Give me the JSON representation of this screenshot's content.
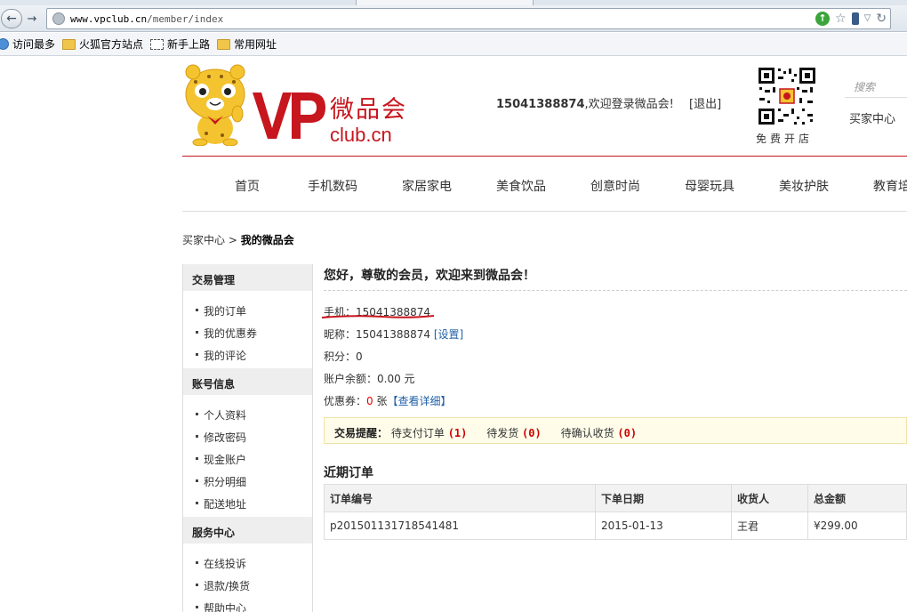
{
  "browser": {
    "url_host": "www.vpclub.cn",
    "url_path": "/member/index",
    "bookmarks": [
      "访问最多",
      "火狐官方站点",
      "新手上路",
      "常用网址"
    ]
  },
  "header": {
    "brand_cn": "微品会",
    "brand_en": "club.cn",
    "welcome_phone": "15041388874",
    "welcome_text": ",欢迎登录微品会!",
    "logout_label": "[退出]",
    "qr_caption": "免费开店",
    "search_placeholder": "搜索",
    "buyer_center_label": "买家中心"
  },
  "nav": {
    "items": [
      "首页",
      "手机数码",
      "家居家电",
      "美食饮品",
      "创意时尚",
      "母婴玩具",
      "美妆护肤",
      "教育培"
    ]
  },
  "breadcrumb": {
    "parent": "买家中心",
    "separator": " > ",
    "current": "我的微品会"
  },
  "sidebar": {
    "sections": [
      {
        "title": "交易管理",
        "items": [
          "我的订单",
          "我的优惠券",
          "我的评论"
        ]
      },
      {
        "title": "账号信息",
        "items": [
          "个人资料",
          "修改密码",
          "现金账户",
          "积分明细",
          "配送地址"
        ]
      },
      {
        "title": "服务中心",
        "items": [
          "在线投诉",
          "退款/换货",
          "帮助中心"
        ]
      }
    ]
  },
  "main": {
    "greeting": "您好，尊敬的会员，欢迎来到微品会！",
    "mobile_label": "手机：",
    "mobile_value": "15041388874",
    "nickname_label": "昵称：",
    "nickname_value": "15041388874",
    "nickname_link": "[设置]",
    "points_label": "积分：",
    "points_value": "0",
    "balance_label": "账户余额：",
    "balance_value": "0.00 元",
    "coupon_label": "优惠券：",
    "coupon_count": "0",
    "coupon_unit": " 张",
    "coupon_link": "【查看详细】",
    "reminder": {
      "title": "交易提醒：",
      "pending_pay_label": "待支付订单",
      "pending_pay_count": "(1)",
      "pending_ship_label": "待发货",
      "pending_ship_count": "(0)",
      "pending_receive_label": "待确认收货",
      "pending_receive_count": "(0)"
    },
    "orders_title": "近期订单",
    "orders_columns": [
      "订单编号",
      "下单日期",
      "收货人",
      "总金额"
    ],
    "orders_rows": [
      [
        "p201501131718541481",
        "2015-01-13",
        "王君",
        "¥299.00"
      ]
    ]
  },
  "colors": {
    "brand_red": "#c7161e",
    "link_blue": "#2060a8",
    "alert_red": "#cc0000"
  }
}
